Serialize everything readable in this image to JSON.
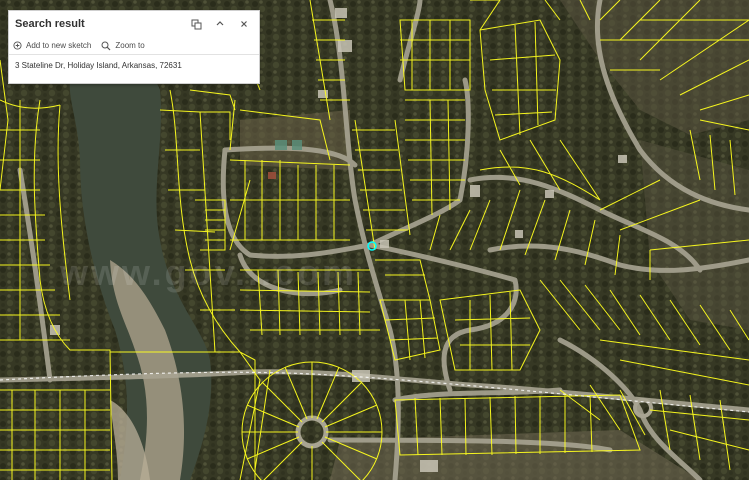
{
  "panel": {
    "title": "Search result",
    "add_to_sketch": "Add to new sketch",
    "zoom_to": "Zoom to",
    "address": "3 Stateline Dr, Holiday Island, Arkansas, 72631"
  },
  "map": {
    "watermark": "www.gov...com",
    "colors": {
      "parcel_lines": "#ffff1e",
      "land": "#3c3d2a",
      "water": "#3f4a3c",
      "road": "#a8a492",
      "sandbar": "#a49b85"
    }
  }
}
